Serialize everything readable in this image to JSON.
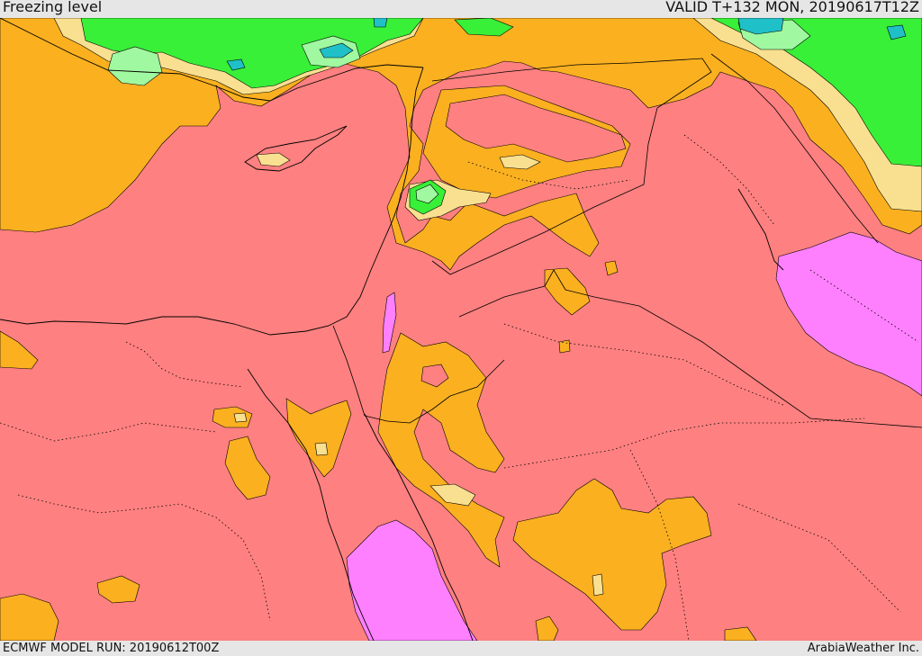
{
  "header": {
    "title": "Freezing level",
    "valid": "VALID T+132 MON, 20190617T12Z"
  },
  "footer": {
    "model_run": "ECMWF MODEL RUN: 20190612T00Z",
    "credit": "ArabiaWeather Inc."
  },
  "map": {
    "fields": [
      {
        "name": "freezing-level-low",
        "color": "#60e0ff"
      },
      {
        "name": "freezing-level-cyan",
        "color": "#20c0c8"
      },
      {
        "name": "freezing-level-lightgreen",
        "color": "#a0f8a0"
      },
      {
        "name": "freezing-level-green",
        "color": "#38f038"
      },
      {
        "name": "freezing-level-paleyellow",
        "color": "#f8e090"
      },
      {
        "name": "freezing-level-orange",
        "color": "#fbb020"
      },
      {
        "name": "freezing-level-salmon",
        "color": "#ff8080"
      },
      {
        "name": "freezing-level-magenta",
        "color": "#ff80ff"
      }
    ],
    "coastline_color": "#000000",
    "border_color": "#000000"
  }
}
